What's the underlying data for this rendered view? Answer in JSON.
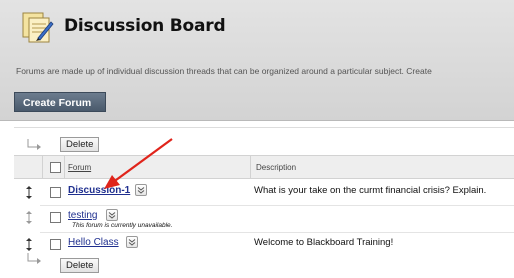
{
  "header": {
    "title": "Discussion Board",
    "description": "Forums are made up of individual discussion threads that can be organized around a particular subject. Create",
    "icon": "discussion-board-icon",
    "create_forum_label": "Create Forum"
  },
  "action_bar": {
    "delete_label": "Delete"
  },
  "table": {
    "columns": {
      "forum": "Forum",
      "description": "Description"
    },
    "rows": [
      {
        "name": "Discussion-1",
        "description": "What is your take on the curmt financial crisis? Explain.",
        "note": "",
        "available": true
      },
      {
        "name": "testing",
        "description": "",
        "note": "This forum is currently unavailable.",
        "available": false
      },
      {
        "name": "Hello Class",
        "description": "Welcome to Blackboard Training!",
        "note": "",
        "available": true
      }
    ]
  },
  "colors": {
    "link": "#1f2f8f",
    "header_bg": "#d9d9d9",
    "button_bg": "#56667a",
    "annotation_arrow": "#e0241b"
  }
}
